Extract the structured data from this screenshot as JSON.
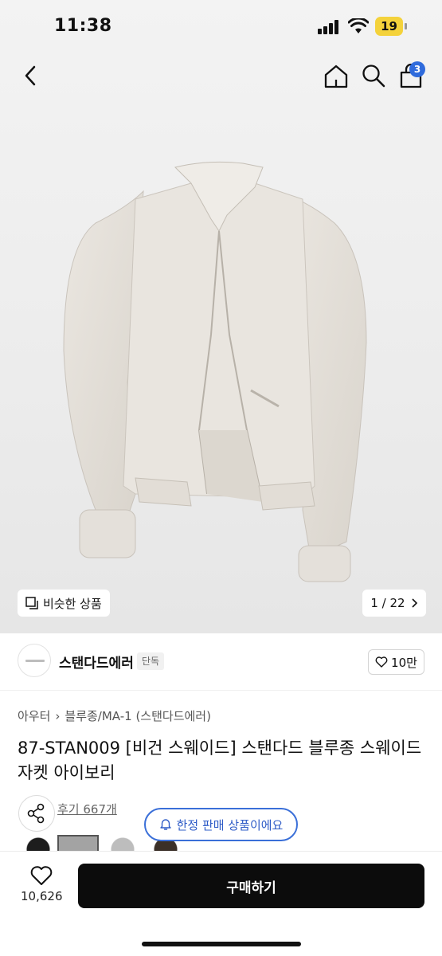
{
  "status_bar": {
    "time": "11:38",
    "battery": "19"
  },
  "nav": {
    "cart_count": "3"
  },
  "gallery": {
    "similar_label": "비슷한 상품",
    "pager": "1 / 22"
  },
  "brand": {
    "name": "스탠다드에러",
    "tag": "단독",
    "likes": "10만"
  },
  "product": {
    "breadcrumb": [
      "아우터",
      "블루종/MA-1 (스탠다드에러)"
    ],
    "title": "87-STAN009 [비건 스웨이드] 스탠다드 블루종 스웨이드 자켓 아이보리",
    "reviews": "후기 667개",
    "limited_label": "한정 판매 상품이에요"
  },
  "bottom": {
    "wish_count": "10,626",
    "buy_label": "구매하기"
  },
  "colors": {
    "accent": "#2f6bdc",
    "buy_button": "#0c0c0c",
    "battery": "#f4d23b"
  }
}
